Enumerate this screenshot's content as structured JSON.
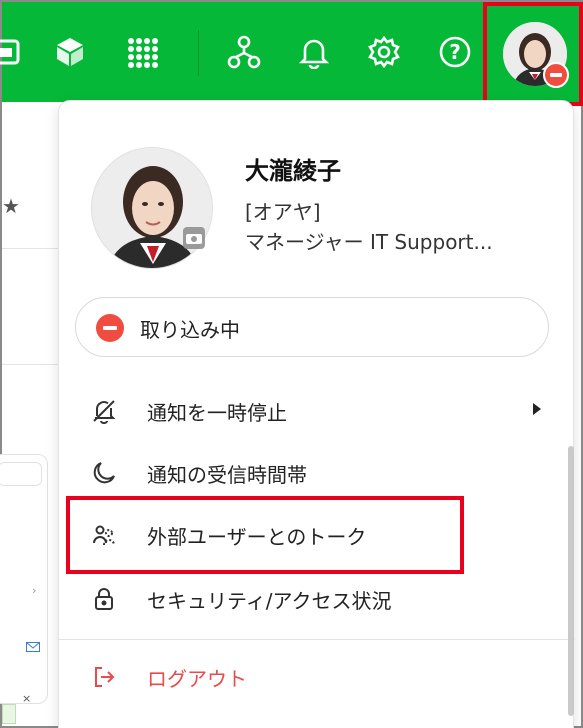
{
  "colors": {
    "header_bg": "#06b838",
    "highlight": "#e8001c",
    "status_busy": "#f04c40",
    "logout": "#e84b4b"
  },
  "header": {
    "icons": [
      "app-square-icon",
      "cube-icon",
      "app-grid-icon",
      "org-chart-icon",
      "bell-icon",
      "gear-icon",
      "help-icon"
    ],
    "help_glyph": "?"
  },
  "profile": {
    "name": "大瀧綾子",
    "reading": "[オアヤ]",
    "title": "マネージャー IT Support..."
  },
  "status": {
    "label": "取り込み中"
  },
  "menu": {
    "items": [
      {
        "label": "通知を一時停止",
        "icon": "bell-off-icon",
        "submenu": true
      },
      {
        "label": "通知の受信時間帯",
        "icon": "moon-icon"
      },
      {
        "label": "外部ユーザーとのトーク",
        "icon": "external-users-icon"
      },
      {
        "label": "セキュリティ/アクセス状況",
        "icon": "lock-icon"
      }
    ],
    "logout_label": "ログアウト"
  },
  "background": {
    "star": "★",
    "chevron": "›",
    "close": "×"
  }
}
